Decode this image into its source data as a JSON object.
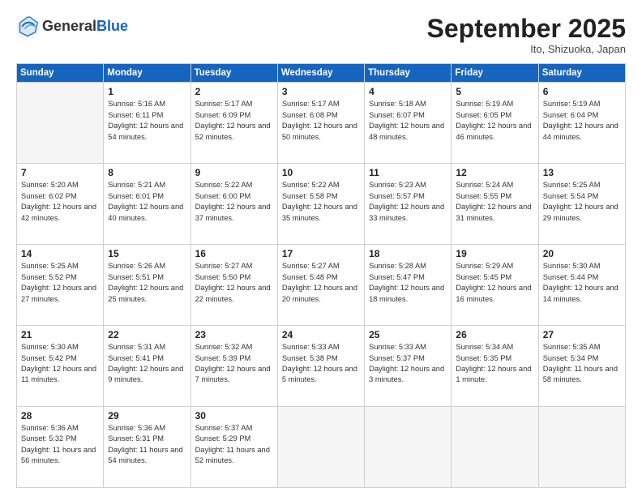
{
  "header": {
    "logo_general": "General",
    "logo_blue": "Blue",
    "month_title": "September 2025",
    "location": "Ito, Shizuoka, Japan"
  },
  "weekdays": [
    "Sunday",
    "Monday",
    "Tuesday",
    "Wednesday",
    "Thursday",
    "Friday",
    "Saturday"
  ],
  "weeks": [
    [
      {
        "day": "",
        "info": ""
      },
      {
        "day": "1",
        "info": "Sunrise: 5:16 AM\nSunset: 6:11 PM\nDaylight: 12 hours\nand 54 minutes."
      },
      {
        "day": "2",
        "info": "Sunrise: 5:17 AM\nSunset: 6:09 PM\nDaylight: 12 hours\nand 52 minutes."
      },
      {
        "day": "3",
        "info": "Sunrise: 5:17 AM\nSunset: 6:08 PM\nDaylight: 12 hours\nand 50 minutes."
      },
      {
        "day": "4",
        "info": "Sunrise: 5:18 AM\nSunset: 6:07 PM\nDaylight: 12 hours\nand 48 minutes."
      },
      {
        "day": "5",
        "info": "Sunrise: 5:19 AM\nSunset: 6:05 PM\nDaylight: 12 hours\nand 46 minutes."
      },
      {
        "day": "6",
        "info": "Sunrise: 5:19 AM\nSunset: 6:04 PM\nDaylight: 12 hours\nand 44 minutes."
      }
    ],
    [
      {
        "day": "7",
        "info": "Sunrise: 5:20 AM\nSunset: 6:02 PM\nDaylight: 12 hours\nand 42 minutes."
      },
      {
        "day": "8",
        "info": "Sunrise: 5:21 AM\nSunset: 6:01 PM\nDaylight: 12 hours\nand 40 minutes."
      },
      {
        "day": "9",
        "info": "Sunrise: 5:22 AM\nSunset: 6:00 PM\nDaylight: 12 hours\nand 37 minutes."
      },
      {
        "day": "10",
        "info": "Sunrise: 5:22 AM\nSunset: 5:58 PM\nDaylight: 12 hours\nand 35 minutes."
      },
      {
        "day": "11",
        "info": "Sunrise: 5:23 AM\nSunset: 5:57 PM\nDaylight: 12 hours\nand 33 minutes."
      },
      {
        "day": "12",
        "info": "Sunrise: 5:24 AM\nSunset: 5:55 PM\nDaylight: 12 hours\nand 31 minutes."
      },
      {
        "day": "13",
        "info": "Sunrise: 5:25 AM\nSunset: 5:54 PM\nDaylight: 12 hours\nand 29 minutes."
      }
    ],
    [
      {
        "day": "14",
        "info": "Sunrise: 5:25 AM\nSunset: 5:52 PM\nDaylight: 12 hours\nand 27 minutes."
      },
      {
        "day": "15",
        "info": "Sunrise: 5:26 AM\nSunset: 5:51 PM\nDaylight: 12 hours\nand 25 minutes."
      },
      {
        "day": "16",
        "info": "Sunrise: 5:27 AM\nSunset: 5:50 PM\nDaylight: 12 hours\nand 22 minutes."
      },
      {
        "day": "17",
        "info": "Sunrise: 5:27 AM\nSunset: 5:48 PM\nDaylight: 12 hours\nand 20 minutes."
      },
      {
        "day": "18",
        "info": "Sunrise: 5:28 AM\nSunset: 5:47 PM\nDaylight: 12 hours\nand 18 minutes."
      },
      {
        "day": "19",
        "info": "Sunrise: 5:29 AM\nSunset: 5:45 PM\nDaylight: 12 hours\nand 16 minutes."
      },
      {
        "day": "20",
        "info": "Sunrise: 5:30 AM\nSunset: 5:44 PM\nDaylight: 12 hours\nand 14 minutes."
      }
    ],
    [
      {
        "day": "21",
        "info": "Sunrise: 5:30 AM\nSunset: 5:42 PM\nDaylight: 12 hours\nand 11 minutes."
      },
      {
        "day": "22",
        "info": "Sunrise: 5:31 AM\nSunset: 5:41 PM\nDaylight: 12 hours\nand 9 minutes."
      },
      {
        "day": "23",
        "info": "Sunrise: 5:32 AM\nSunset: 5:39 PM\nDaylight: 12 hours\nand 7 minutes."
      },
      {
        "day": "24",
        "info": "Sunrise: 5:33 AM\nSunset: 5:38 PM\nDaylight: 12 hours\nand 5 minutes."
      },
      {
        "day": "25",
        "info": "Sunrise: 5:33 AM\nSunset: 5:37 PM\nDaylight: 12 hours\nand 3 minutes."
      },
      {
        "day": "26",
        "info": "Sunrise: 5:34 AM\nSunset: 5:35 PM\nDaylight: 12 hours\nand 1 minute."
      },
      {
        "day": "27",
        "info": "Sunrise: 5:35 AM\nSunset: 5:34 PM\nDaylight: 11 hours\nand 58 minutes."
      }
    ],
    [
      {
        "day": "28",
        "info": "Sunrise: 5:36 AM\nSunset: 5:32 PM\nDaylight: 11 hours\nand 56 minutes."
      },
      {
        "day": "29",
        "info": "Sunrise: 5:36 AM\nSunset: 5:31 PM\nDaylight: 11 hours\nand 54 minutes."
      },
      {
        "day": "30",
        "info": "Sunrise: 5:37 AM\nSunset: 5:29 PM\nDaylight: 11 hours\nand 52 minutes."
      },
      {
        "day": "",
        "info": ""
      },
      {
        "day": "",
        "info": ""
      },
      {
        "day": "",
        "info": ""
      },
      {
        "day": "",
        "info": ""
      }
    ]
  ]
}
